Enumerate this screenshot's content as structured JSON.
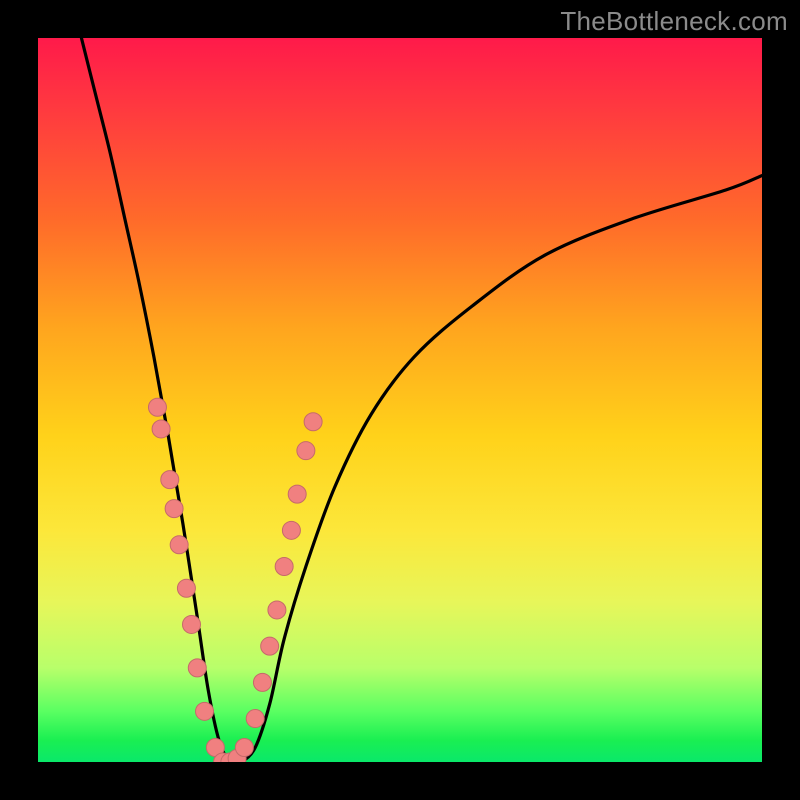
{
  "watermark": "TheBottleneck.com",
  "chart_data": {
    "type": "line",
    "title": "",
    "xlabel": "",
    "ylabel": "",
    "xlim": [
      0,
      100
    ],
    "ylim": [
      0,
      100
    ],
    "series": [
      {
        "name": "bottleneck-curve",
        "x": [
          6,
          8,
          10,
          12,
          14,
          16,
          18,
          20,
          22,
          23.5,
          25,
          26.5,
          28,
          30,
          32,
          34,
          37,
          41,
          46,
          52,
          60,
          70,
          82,
          95,
          100
        ],
        "y": [
          100,
          92,
          84,
          75,
          66,
          56,
          45,
          33,
          20,
          10,
          3,
          0,
          0,
          2,
          8,
          17,
          27,
          38,
          48,
          56,
          63,
          70,
          75,
          79,
          81
        ]
      }
    ],
    "markers": [
      {
        "x": 16.5,
        "y": 49
      },
      {
        "x": 17.0,
        "y": 46
      },
      {
        "x": 18.2,
        "y": 39
      },
      {
        "x": 18.8,
        "y": 35
      },
      {
        "x": 19.5,
        "y": 30
      },
      {
        "x": 20.5,
        "y": 24
      },
      {
        "x": 21.2,
        "y": 19
      },
      {
        "x": 22.0,
        "y": 13
      },
      {
        "x": 23.0,
        "y": 7
      },
      {
        "x": 24.5,
        "y": 2
      },
      {
        "x": 25.5,
        "y": 0
      },
      {
        "x": 26.5,
        "y": 0
      },
      {
        "x": 27.5,
        "y": 0.5
      },
      {
        "x": 28.5,
        "y": 2
      },
      {
        "x": 30.0,
        "y": 6
      },
      {
        "x": 31.0,
        "y": 11
      },
      {
        "x": 32.0,
        "y": 16
      },
      {
        "x": 33.0,
        "y": 21
      },
      {
        "x": 34.0,
        "y": 27
      },
      {
        "x": 35.0,
        "y": 32
      },
      {
        "x": 35.8,
        "y": 37
      },
      {
        "x": 37.0,
        "y": 43
      },
      {
        "x": 38.0,
        "y": 47
      }
    ],
    "colors": {
      "curve": "#000000",
      "marker_fill": "#f08080",
      "marker_stroke": "#c56a6a"
    }
  }
}
